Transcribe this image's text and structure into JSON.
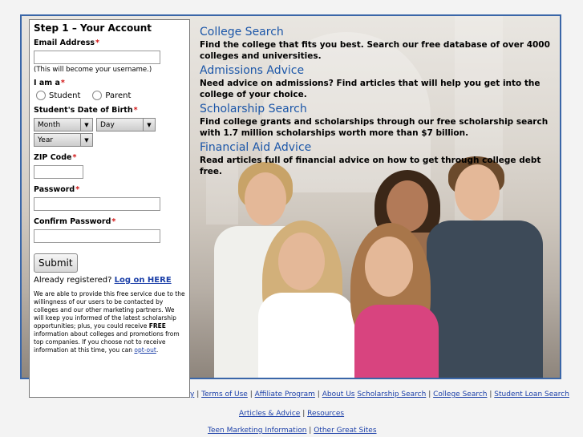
{
  "form": {
    "title": "Step 1 – Your Account",
    "email_label": "Email Address",
    "email_value": "",
    "email_hint": "(This will become your username.)",
    "iam_label": "I am a",
    "role_options": [
      "Student",
      "Parent"
    ],
    "dob_label": "Student's Date of Birth",
    "month_selected": "Month",
    "day_selected": "Day",
    "year_selected": "Year",
    "zip_label": "ZIP Code",
    "password_label": "Password",
    "confirm_password_label": "Confirm Password",
    "submit_label": "Submit",
    "already_registered": "Already registered?",
    "login_link": "Log on HERE",
    "required_marker": "*",
    "disclaimer_before": "We are able to provide this free service due to the willingness of our users to be contacted by colleges and our other marketing partners. We will keep you informed of the latest scholarship opportunities; plus, you could receive ",
    "disclaimer_bold": "FREE",
    "disclaimer_after": " information about colleges and promotions from top companies. If you choose not to receive information at this time, you can ",
    "opt_out_link": "opt-out",
    "disclaimer_end": "."
  },
  "info": [
    {
      "heading": "College Search",
      "text": "Find the college that fits you best. Search our free database of over 4000 colleges and universities."
    },
    {
      "heading": "Admissions Advice",
      "text": "Need advice on admissions? Find articles that will help you get into the college of your choice."
    },
    {
      "heading": "Scholarship Search",
      "text": "Find college grants and scholarships through our free scholarship search with 1.7 million scholarships worth more than $7 billion."
    },
    {
      "heading": "Financial Aid Advice",
      "text": "Read articles full of financial advice on how to get through college debt free."
    }
  ],
  "footer": {
    "row1_partial": "y",
    "row1": [
      "Terms of Use",
      "Affiliate Program",
      "About Us",
      "Scholarship Search",
      "College Search",
      "Student Loan Search"
    ],
    "row2": [
      "Articles & Advice",
      "Resources"
    ],
    "row3": [
      "Teen Marketing Information",
      "Other Great Sites"
    ],
    "separator": "|"
  },
  "colors": {
    "accent": "#1b56a8",
    "border": "#3a66a8",
    "required": "#d21515",
    "link": "#1b3fa8"
  }
}
